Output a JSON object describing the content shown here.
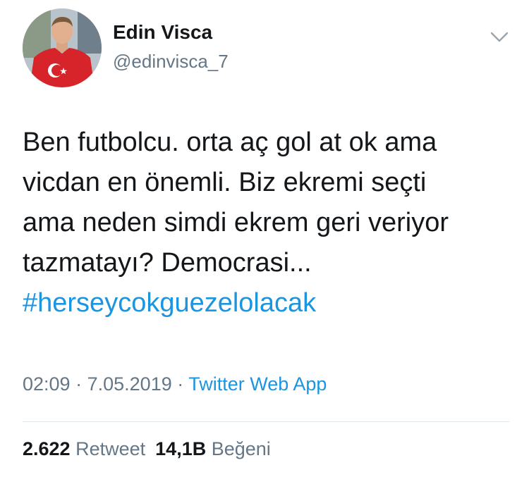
{
  "author": {
    "display_name": "Edin Visca",
    "handle": "@edinvisca_7"
  },
  "tweet": {
    "text_lines": [
      "Ben futbolcu. orta aç gol at ok ama",
      "vicdan en önemli. Biz ekremi seçti",
      "ama neden simdi ekrem geri veriyor",
      "tazmatayı? Democrasi..."
    ],
    "hashtag": "#herseycokguezelolacak",
    "time": "02:09",
    "separator": "·",
    "date": "7.05.2019",
    "source": "Twitter Web App"
  },
  "stats": {
    "retweets_count": "2.622",
    "retweets_label": "Retweet",
    "likes_count": "14,1B",
    "likes_label": "Beğeni"
  },
  "icons": {
    "menu": "chevron-down-icon",
    "avatar_flag": "turkish-flag-emblem"
  },
  "colors": {
    "link": "#1b95e0",
    "secondary_text": "#657786",
    "primary_text": "#14171a",
    "divider": "#e1e8ed",
    "shirt": "#d7242a"
  }
}
